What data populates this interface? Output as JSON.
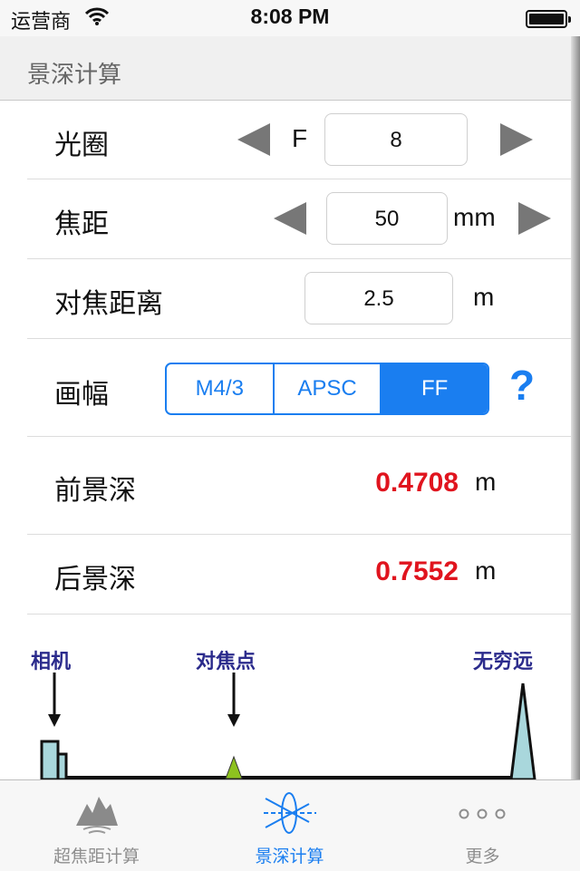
{
  "status_bar": {
    "carrier": "运营商",
    "time": "8:08 PM"
  },
  "nav": {
    "title": "景深计算"
  },
  "aperture": {
    "label": "光圈",
    "prefix": "F",
    "value": "8"
  },
  "focal_length": {
    "label": "焦距",
    "value": "50",
    "unit": "mm"
  },
  "focus_distance": {
    "label": "对焦距离",
    "value": "2.5",
    "unit": "m"
  },
  "format": {
    "label": "画幅",
    "options": [
      "M4/3",
      "APSC",
      "FF"
    ],
    "selected": "FF",
    "help": "?"
  },
  "front_dof": {
    "label": "前景深",
    "value": "0.4708",
    "unit": "m"
  },
  "rear_dof": {
    "label": "后景深",
    "value": "0.7552",
    "unit": "m"
  },
  "diagram": {
    "camera": "相机",
    "focus_point": "对焦点",
    "infinity": "无穷远"
  },
  "colors": {
    "accent": "#1a7ef0",
    "result": "#e0141e",
    "diagram_label": "#2b2b8c",
    "marker": "#8dc21f",
    "shape_fill": "#a9d7dc"
  },
  "tabs": [
    {
      "label": "超焦距计算",
      "icon": "mountain-icon",
      "active": false
    },
    {
      "label": "景深计算",
      "icon": "lens-icon",
      "active": true
    },
    {
      "label": "更多",
      "icon": "more-dots-icon",
      "active": false
    }
  ]
}
